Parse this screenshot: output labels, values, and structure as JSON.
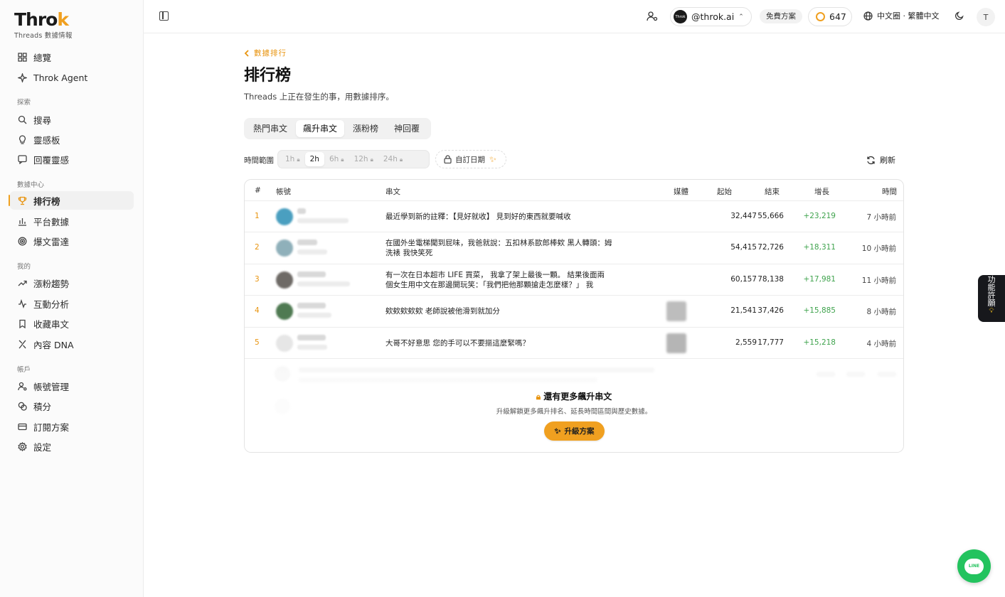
{
  "brand": {
    "logo_main": "Thro",
    "logo_accent": "k",
    "subtitle": "Threads 數據情報"
  },
  "sidebar": {
    "items_top": [
      {
        "label": "總覽",
        "icon": "grid-icon"
      },
      {
        "label": "Throk Agent",
        "icon": "sparkle-icon"
      }
    ],
    "section_explore": "探索",
    "items_explore": [
      {
        "label": "搜尋",
        "icon": "search-icon"
      },
      {
        "label": "靈感板",
        "icon": "bulb-icon"
      },
      {
        "label": "回覆靈感",
        "icon": "reply-icon"
      }
    ],
    "section_data": "數據中心",
    "items_data": [
      {
        "label": "排行榜",
        "icon": "trophy-icon"
      },
      {
        "label": "平台數據",
        "icon": "bar-chart-icon"
      },
      {
        "label": "爆文雷達",
        "icon": "radar-icon"
      }
    ],
    "section_mine": "我的",
    "items_mine": [
      {
        "label": "漲粉趨勢",
        "icon": "trend-icon"
      },
      {
        "label": "互動分析",
        "icon": "activity-icon"
      },
      {
        "label": "收藏串文",
        "icon": "bookmark-icon"
      },
      {
        "label": "內容 DNA",
        "icon": "dna-icon"
      }
    ],
    "section_account": "帳戶",
    "items_account": [
      {
        "label": "帳號管理",
        "icon": "user-cog-icon"
      },
      {
        "label": "積分",
        "icon": "coins-icon"
      },
      {
        "label": "訂閱方案",
        "icon": "card-icon"
      },
      {
        "label": "設定",
        "icon": "gear-icon"
      }
    ]
  },
  "topbar": {
    "account_avatar_text": "Throk",
    "account_handle": "@throk.ai",
    "plan": "免費方案",
    "credits": "647",
    "language": "中文圈 · 繁體中文",
    "user_initial": "T"
  },
  "main": {
    "back_label": "數據排行",
    "title": "排行榜",
    "subtitle": "Threads 上正在發生的事，用數據排序。",
    "tabs": [
      "熱門串文",
      "飆升串文",
      "漲粉榜",
      "神回覆"
    ],
    "active_tab": 1,
    "time_range_label": "時間範圍",
    "time_ranges": [
      "1h",
      "2h",
      "6h",
      "12h",
      "24h"
    ],
    "active_range": 1,
    "custom_date": "自訂日期",
    "refresh": "刷新"
  },
  "table": {
    "headers": {
      "rank": "#",
      "account": "帳號",
      "post": "串文",
      "media": "媒體",
      "start": "起始",
      "end": "結束",
      "growth": "增長",
      "time": "時間"
    },
    "rows": [
      {
        "rank": "1",
        "avatar_color": "#4a9fc0",
        "post": "最近學到新的註釋：【見好就收】 見到好的東西就要喊收",
        "media": false,
        "start": "32,447",
        "end": "55,666",
        "growth": "+23,219",
        "time": "7 小時前"
      },
      {
        "rank": "2",
        "avatar_color": "#8fb0ba",
        "post": "在國外坐電梯聞到屁味，我爸就說：五扣林系歐郎棒欸 黑人轉頭：姆洗裱 我快笑死",
        "media": false,
        "start": "54,415",
        "end": "72,726",
        "growth": "+18,311",
        "time": "10 小時前"
      },
      {
        "rank": "3",
        "avatar_color": "#6e6a66",
        "post": "有一次在日本超市 LIFE 買菜， 我拿了架上最後一顆。 結果後面兩個女生用中文在那邊開玩笑：「我們把他那顆搶走怎麼樣？」 我回...",
        "media": false,
        "start": "60,157",
        "end": "78,138",
        "growth": "+17,981",
        "time": "11 小時前"
      },
      {
        "rank": "4",
        "avatar_color": "#4f7a52",
        "post": "欸欸欸欸欸 老師說被他滑到就加分",
        "media": true,
        "start": "21,541",
        "end": "37,426",
        "growth": "+15,885",
        "time": "8 小時前"
      },
      {
        "rank": "5",
        "avatar_color": "#e6e6e6",
        "post": "大哥不好意思 您的手可以不要摳這麼緊嗎？",
        "media": true,
        "start": "2,559",
        "end": "17,777",
        "growth": "+15,218",
        "time": "4 小時前"
      }
    ],
    "more_title": "還有更多飆升串文",
    "more_subtitle": "升級解鎖更多飆升排名、延長時間區間與歷史數據。",
    "upgrade_button": "升級方案"
  },
  "wish_tab": [
    "功",
    "能",
    "許",
    "願"
  ],
  "line_button": "LINE"
}
